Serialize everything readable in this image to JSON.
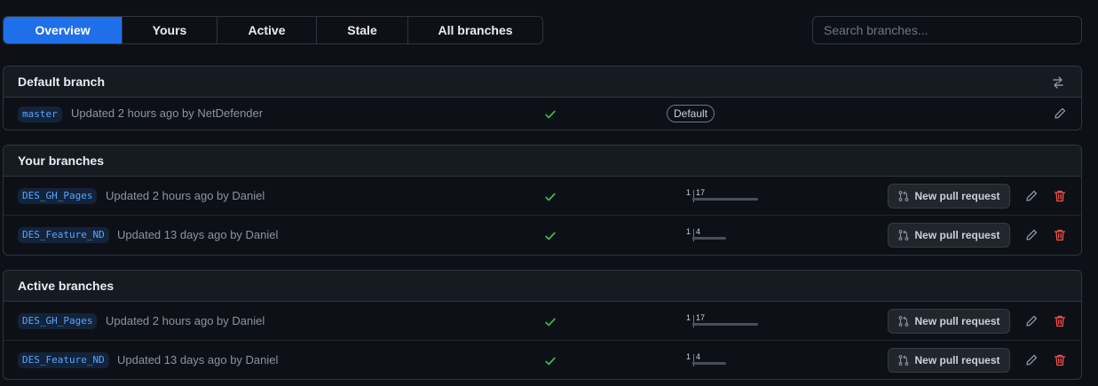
{
  "tabs": [
    {
      "label": "Overview",
      "active": true
    },
    {
      "label": "Yours",
      "active": false
    },
    {
      "label": "Active",
      "active": false
    },
    {
      "label": "Stale",
      "active": false
    },
    {
      "label": "All branches",
      "active": false
    }
  ],
  "search": {
    "placeholder": "Search branches..."
  },
  "default_section": {
    "title": "Default branch",
    "rows": [
      {
        "branch": "master",
        "updated": "Updated 2 hours ago by NetDefender",
        "badge": "Default",
        "status": "success"
      }
    ]
  },
  "your_section": {
    "title": "Your branches",
    "rows": [
      {
        "branch": "DES_GH_Pages",
        "updated": "Updated 2 hours ago by Daniel",
        "behind": "1",
        "ahead": "17",
        "ahead_count": 17,
        "status": "success",
        "pr_label": "New pull request"
      },
      {
        "branch": "DES_Feature_ND",
        "updated": "Updated 13 days ago by Daniel",
        "behind": "1",
        "ahead": "4",
        "ahead_count": 4,
        "status": "success",
        "pr_label": "New pull request"
      }
    ]
  },
  "active_section": {
    "title": "Active branches",
    "rows": [
      {
        "branch": "DES_GH_Pages",
        "updated": "Updated 2 hours ago by Daniel",
        "behind": "1",
        "ahead": "17",
        "ahead_count": 17,
        "status": "success",
        "pr_label": "New pull request"
      },
      {
        "branch": "DES_Feature_ND",
        "updated": "Updated 13 days ago by Daniel",
        "behind": "1",
        "ahead": "4",
        "ahead_count": 4,
        "status": "success",
        "pr_label": "New pull request"
      }
    ]
  },
  "colors": {
    "accent": "#1f6feb",
    "success": "#3fb950",
    "danger": "#f85149",
    "branch_link": "#58a6ff"
  }
}
